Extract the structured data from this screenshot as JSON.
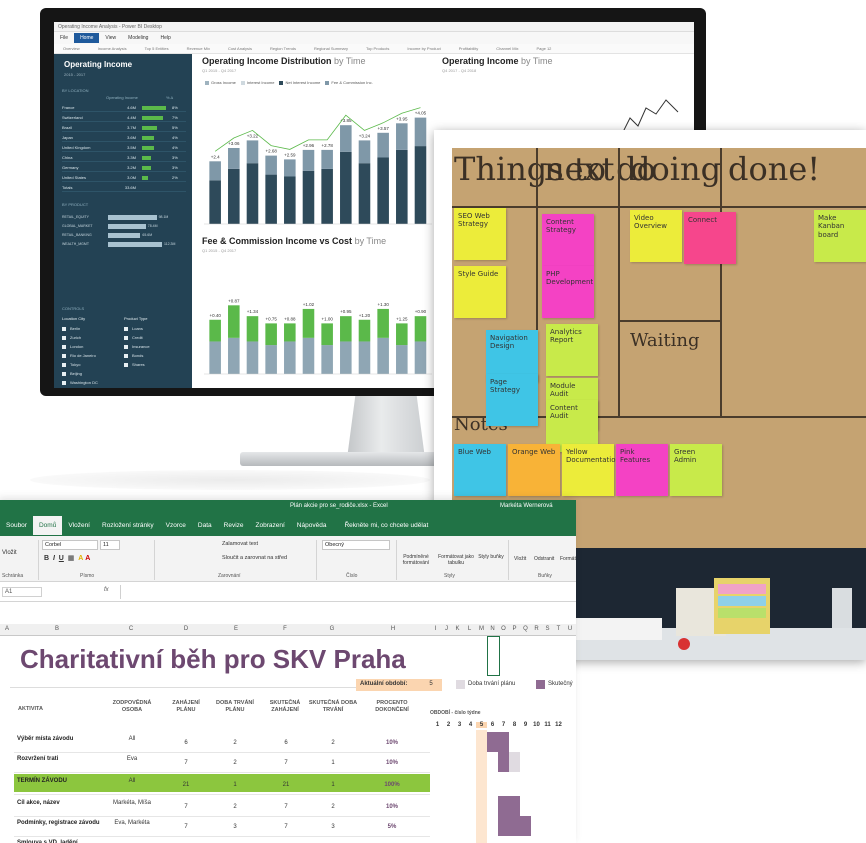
{
  "monitor": {
    "titlebar": "Operating Income Analysis - Power BI Desktop",
    "menu": [
      "File",
      "Home",
      "View",
      "Modeling",
      "Help"
    ],
    "menu_active": "Home",
    "page_tabs": [
      "Overview",
      "Income Analysis",
      "Top 5 Entities",
      "Revenue Mix",
      "Cost Analysis",
      "Region Trends",
      "Regional Summary",
      "Top Products",
      "Income by Product",
      "Profitability",
      "Channel Mix",
      "Page 12"
    ],
    "sidebar": {
      "title": "Operating Income",
      "subtitle": "2015 - 2017",
      "section_location": "BY LOCATION",
      "col_income": "Operating Income",
      "col_delta": "% Δ",
      "rows": [
        {
          "name": "France",
          "value": "4.6M",
          "delta": "8%"
        },
        {
          "name": "Switzerland",
          "value": "4.4M",
          "delta": "7%"
        },
        {
          "name": "Brazil",
          "value": "3.7M",
          "delta": "5%"
        },
        {
          "name": "Japan",
          "value": "3.6M",
          "delta": "4%"
        },
        {
          "name": "United Kingdom",
          "value": "3.5M",
          "delta": "4%"
        },
        {
          "name": "China",
          "value": "3.3M",
          "delta": "3%"
        },
        {
          "name": "Germany",
          "value": "3.2M",
          "delta": "3%"
        },
        {
          "name": "United States",
          "value": "3.0M",
          "delta": "2%"
        },
        {
          "name": "Totals",
          "value": "33.6M",
          "delta": ""
        }
      ],
      "section_product": "BY PRODUCT",
      "product_rows": [
        {
          "name": "RETAIL_EQUITY",
          "value": "98.1M",
          "level": 0.9
        },
        {
          "name": "GLOBAL_MARKET",
          "value": "78.4M",
          "level": 0.7
        },
        {
          "name": "RETAIL_BANKING",
          "value": "65.6M",
          "level": 0.6
        },
        {
          "name": "WEALTH_MGMT",
          "value": "112.3M",
          "level": 1.0
        }
      ],
      "section_controls": "CONTROLS",
      "filter_location": "Location City",
      "filter_product": "Product Type",
      "locations": [
        "Berlin",
        "Zurich",
        "London",
        "Rio de Janeiro",
        "Tokyo",
        "Beijing",
        "Washington DC"
      ],
      "products": [
        "Loans",
        "Credit",
        "Insurance",
        "Bonds",
        "Shares"
      ]
    },
    "chart1": {
      "title_bold": "Operating Income Distribution",
      "title_light": "by Time",
      "subtitle": "Q1 2015 - Q4 2017",
      "legend": [
        "Gross Income",
        "Interest Income",
        "Net Interest Income",
        "Fee & Commission Inc."
      ]
    },
    "chart2": {
      "title_bold": "Operating Income",
      "title_light": "by Time",
      "subtitle": "Q4 2017 - Q4 2018"
    },
    "chart3": {
      "title_bold": "Fee & Commission Income vs Cost",
      "title_light": "by Time",
      "subtitle": "Q1 2015 - Q4 2017"
    },
    "colors": {
      "sidebar": "#234254",
      "bar_dark": "#2e4a5a",
      "bar_mid": "#7f98a8",
      "bar_green": "#5bb94a",
      "accent": "#1f5a9c"
    }
  },
  "chart_data": [
    {
      "type": "bar",
      "title": "Operating Income Distribution by Time",
      "categories": [
        "Q1",
        "Q2",
        "Q3",
        "Q4",
        "Q5",
        "Q6",
        "Q7",
        "Q8",
        "Q9",
        "Q10",
        "Q11",
        "Q12"
      ],
      "series": [
        {
          "name": "Gross Income",
          "values": [
            2.3,
            2.9,
            3.2,
            2.6,
            2.5,
            2.8,
            2.9,
            3.8,
            3.2,
            3.5,
            3.9,
            4.1
          ]
        },
        {
          "name": "Interest Income",
          "values": [
            1.0,
            1.1,
            1.2,
            1.0,
            0.9,
            1.1,
            1.0,
            1.4,
            1.2,
            1.3,
            1.4,
            1.5
          ]
        }
      ],
      "labels": [
        "+2.4",
        "+3.06",
        "+3.22",
        "+2.68",
        "+2.59",
        "+2.96",
        "+2.78",
        "+3.85",
        "+3.24",
        "+3.57",
        "+3.95",
        "+4.05"
      ]
    },
    {
      "type": "bar",
      "title": "Fee & Commission Income vs Cost by Time",
      "categories": [
        "Q1",
        "Q2",
        "Q3",
        "Q4",
        "Q5",
        "Q6",
        "Q7",
        "Q8",
        "Q9",
        "Q10",
        "Q11",
        "Q12"
      ],
      "series": [
        {
          "name": "Income",
          "values": [
            0.9,
            1.0,
            0.9,
            0.8,
            0.9,
            1.0,
            0.8,
            0.9,
            0.9,
            1.0,
            0.8,
            0.9
          ]
        },
        {
          "name": "Cost",
          "values": [
            0.6,
            0.9,
            0.7,
            0.6,
            0.5,
            0.8,
            0.6,
            0.7,
            0.6,
            0.8,
            0.6,
            0.7
          ]
        }
      ],
      "labels": [
        "+0.40",
        "+0.87",
        "+1.34",
        "+0.75",
        "+0.88",
        "+1.02",
        "+1.00",
        "+0.95",
        "+1.20",
        "+1.30",
        "+1.25",
        "+0.90"
      ]
    }
  ],
  "board": {
    "columns": [
      "Things to do",
      "next",
      "doing",
      "done!"
    ],
    "waiting": "Waiting",
    "notes_heading": "Notes",
    "notes": [
      {
        "text": "SEO Web Strategy",
        "color": "y"
      },
      {
        "text": "Content Strategy",
        "color": "p"
      },
      {
        "text": "Style Guide",
        "color": "y"
      },
      {
        "text": "PHP Development",
        "color": "p"
      },
      {
        "text": "Navigation Design",
        "color": "b"
      },
      {
        "text": "Analytics Report",
        "color": "g"
      },
      {
        "text": "Module Audit",
        "color": "g"
      },
      {
        "text": "Content Audit",
        "color": "g"
      },
      {
        "text": "Page Strategy",
        "color": "b"
      },
      {
        "text": "Make Kanban board",
        "color": "g"
      },
      {
        "text": "Video Overview",
        "color": "y"
      },
      {
        "text": "Connect",
        "color": "r"
      },
      {
        "text": "Blue Web",
        "color": "b"
      },
      {
        "text": "Orange Web",
        "color": "o"
      },
      {
        "text": "Yellow Documentation",
        "color": "y"
      },
      {
        "text": "Pink Features",
        "color": "p"
      },
      {
        "text": "Green Admin",
        "color": "g"
      }
    ]
  },
  "excel": {
    "title_bar": "Plán akcie pro se_rodiče.xlsx - Excel",
    "user": "Markéta Wernerová",
    "tabs": [
      "Soubor",
      "Domů",
      "Vložení",
      "Rozložení stránky",
      "Vzorce",
      "Data",
      "Revize",
      "Zobrazení",
      "Nápověda"
    ],
    "tab_active": "Domů",
    "tell_me": "Řekněte mi, co chcete udělat",
    "font_name": "Corbel",
    "font_size": "11",
    "wrap_text": "Zalamovat text",
    "merge_center": "Sloučit a zarovnat na střed",
    "number_format": "Obecný",
    "cond_format": "Podmíněné formátování",
    "format_table": "Formátovat jako tabulku",
    "cell_styles": "Styly buňky",
    "insert": "Vložit",
    "delete": "Odstranit",
    "format": "Formát",
    "paste": "Vložit",
    "groups": [
      "Schránka",
      "Písmo",
      "Zarovnání",
      "Číslo",
      "Styly",
      "Buňky"
    ],
    "name_box": "A1",
    "fx": "fx",
    "columns": [
      "A",
      "B",
      "C",
      "D",
      "E",
      "F",
      "G",
      "H",
      "I",
      "J",
      "K",
      "L",
      "M",
      "N",
      "O",
      "P",
      "Q",
      "R",
      "S",
      "T",
      "U"
    ],
    "sheet_title": "Charitativní běh pro SKV Praha",
    "current_period_label": "Aktuální období:",
    "current_period_value": "5",
    "legend_plan": "Doba trvání plánu",
    "legend_actual": "Skutečný",
    "headers": {
      "activity": "AKTIVITA",
      "owner": "ZODPOVĚDNÁ OSOBA",
      "plan_start": "ZAHÁJENÍ PLÁNU",
      "plan_dur": "DOBA TRVÁNÍ PLÁNU",
      "actual_start": "SKUTEČNÁ ZAHÁJENÍ",
      "actual_dur": "SKUTEČNÁ DOBA TRVÁNÍ",
      "pct": "PROCENTO DOKONČENÍ",
      "period": "OBDOBÍ - číslo týdne"
    },
    "weeks": [
      "1",
      "2",
      "3",
      "4",
      "5",
      "6",
      "7",
      "8",
      "9",
      "10",
      "11",
      "12"
    ],
    "rows": [
      {
        "activity": "Výběr místa závodu",
        "owner": "All",
        "plan_start": "6",
        "plan_dur": "2",
        "actual_start": "6",
        "actual_dur": "2",
        "pct": "10%"
      },
      {
        "activity": "Rozvržení trati",
        "owner": "Eva",
        "plan_start": "7",
        "plan_dur": "2",
        "actual_start": "7",
        "actual_dur": "1",
        "pct": "10%"
      },
      {
        "activity": "TERMÍN ZÁVODU",
        "owner": "All",
        "plan_start": "21",
        "plan_dur": "1",
        "actual_start": "21",
        "actual_dur": "1",
        "pct": "100%"
      },
      {
        "activity": "Cíl akce, název",
        "owner": "Markéta, Míša",
        "plan_start": "7",
        "plan_dur": "2",
        "actual_start": "7",
        "actual_dur": "2",
        "pct": "10%"
      },
      {
        "activity": "Podmínky, registrace závodu",
        "owner": "Eva, Markéta",
        "plan_start": "7",
        "plan_dur": "3",
        "actual_start": "7",
        "actual_dur": "3",
        "pct": "5%"
      },
      {
        "activity": "Smlouva s VD, ladění",
        "owner": "",
        "plan_start": "",
        "plan_dur": "",
        "actual_start": "",
        "actual_dur": "",
        "pct": ""
      }
    ]
  }
}
